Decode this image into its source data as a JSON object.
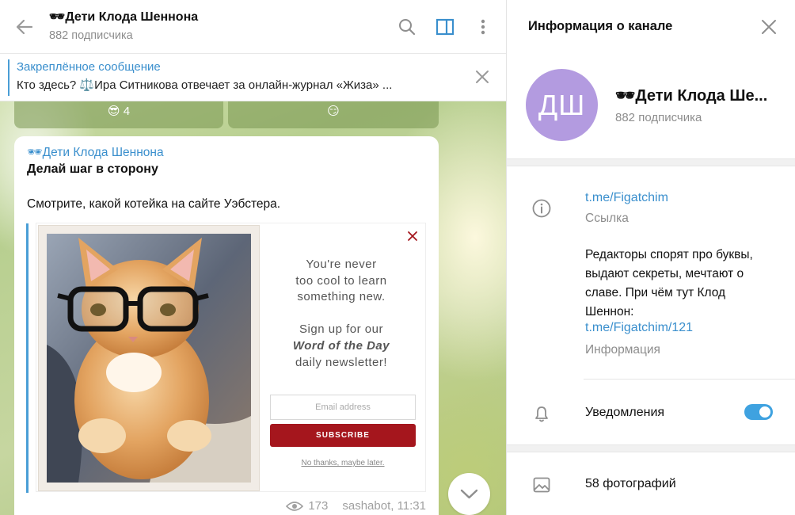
{
  "chat": {
    "title": "🕶Дети Клода Шеннона",
    "subscribers": "882 подписчика"
  },
  "pinned": {
    "title": "Закреплённое сообщение",
    "text": "Кто здесь?  ⚖️Ира Ситникова отвечает за онлайн-журнал «Жиза» ..."
  },
  "reactions": [
    {
      "emoji": "😎",
      "count": "4"
    },
    {
      "emoji": "😏",
      "count": ""
    }
  ],
  "message": {
    "author": "🕶Дети Клода Шеннона",
    "heading": "Делай шаг в сторону",
    "text": "Смотрите, какой котейка на сайте Уэбстера.",
    "views": "173",
    "signature": "sashabot, 11:31"
  },
  "ad": {
    "line1": "You're never",
    "line2": "too cool to learn",
    "line3": "something new.",
    "line4": "Sign up for our",
    "line5": "Word of the Day",
    "line6": "daily newsletter!",
    "email_placeholder": "Email address",
    "subscribe_label": "SUBSCRIBE",
    "decline_label": "No thanks, maybe later."
  },
  "info": {
    "title": "Информация о канале",
    "avatar_initials": "ДШ",
    "avatar_color": "#b39be0",
    "name": "🕶Дети Клода Ше...",
    "subscribers": "882 подписчика",
    "link": "t.me/Figatchim",
    "link_caption": "Ссылка",
    "description": "Редакторы спорят про буквы, выдают секреты, мечтают о славе. При чём тут Клод Шеннон:",
    "description_link": "t.me/Figatchim/121",
    "description_caption": "Информация",
    "notifications_label": "Уведомления",
    "notifications_on": true,
    "photos_label": "58 фотографий"
  },
  "colors": {
    "accent": "#3a8fcd",
    "toggle": "#3fa2e0",
    "subscribe": "#a5161d"
  }
}
